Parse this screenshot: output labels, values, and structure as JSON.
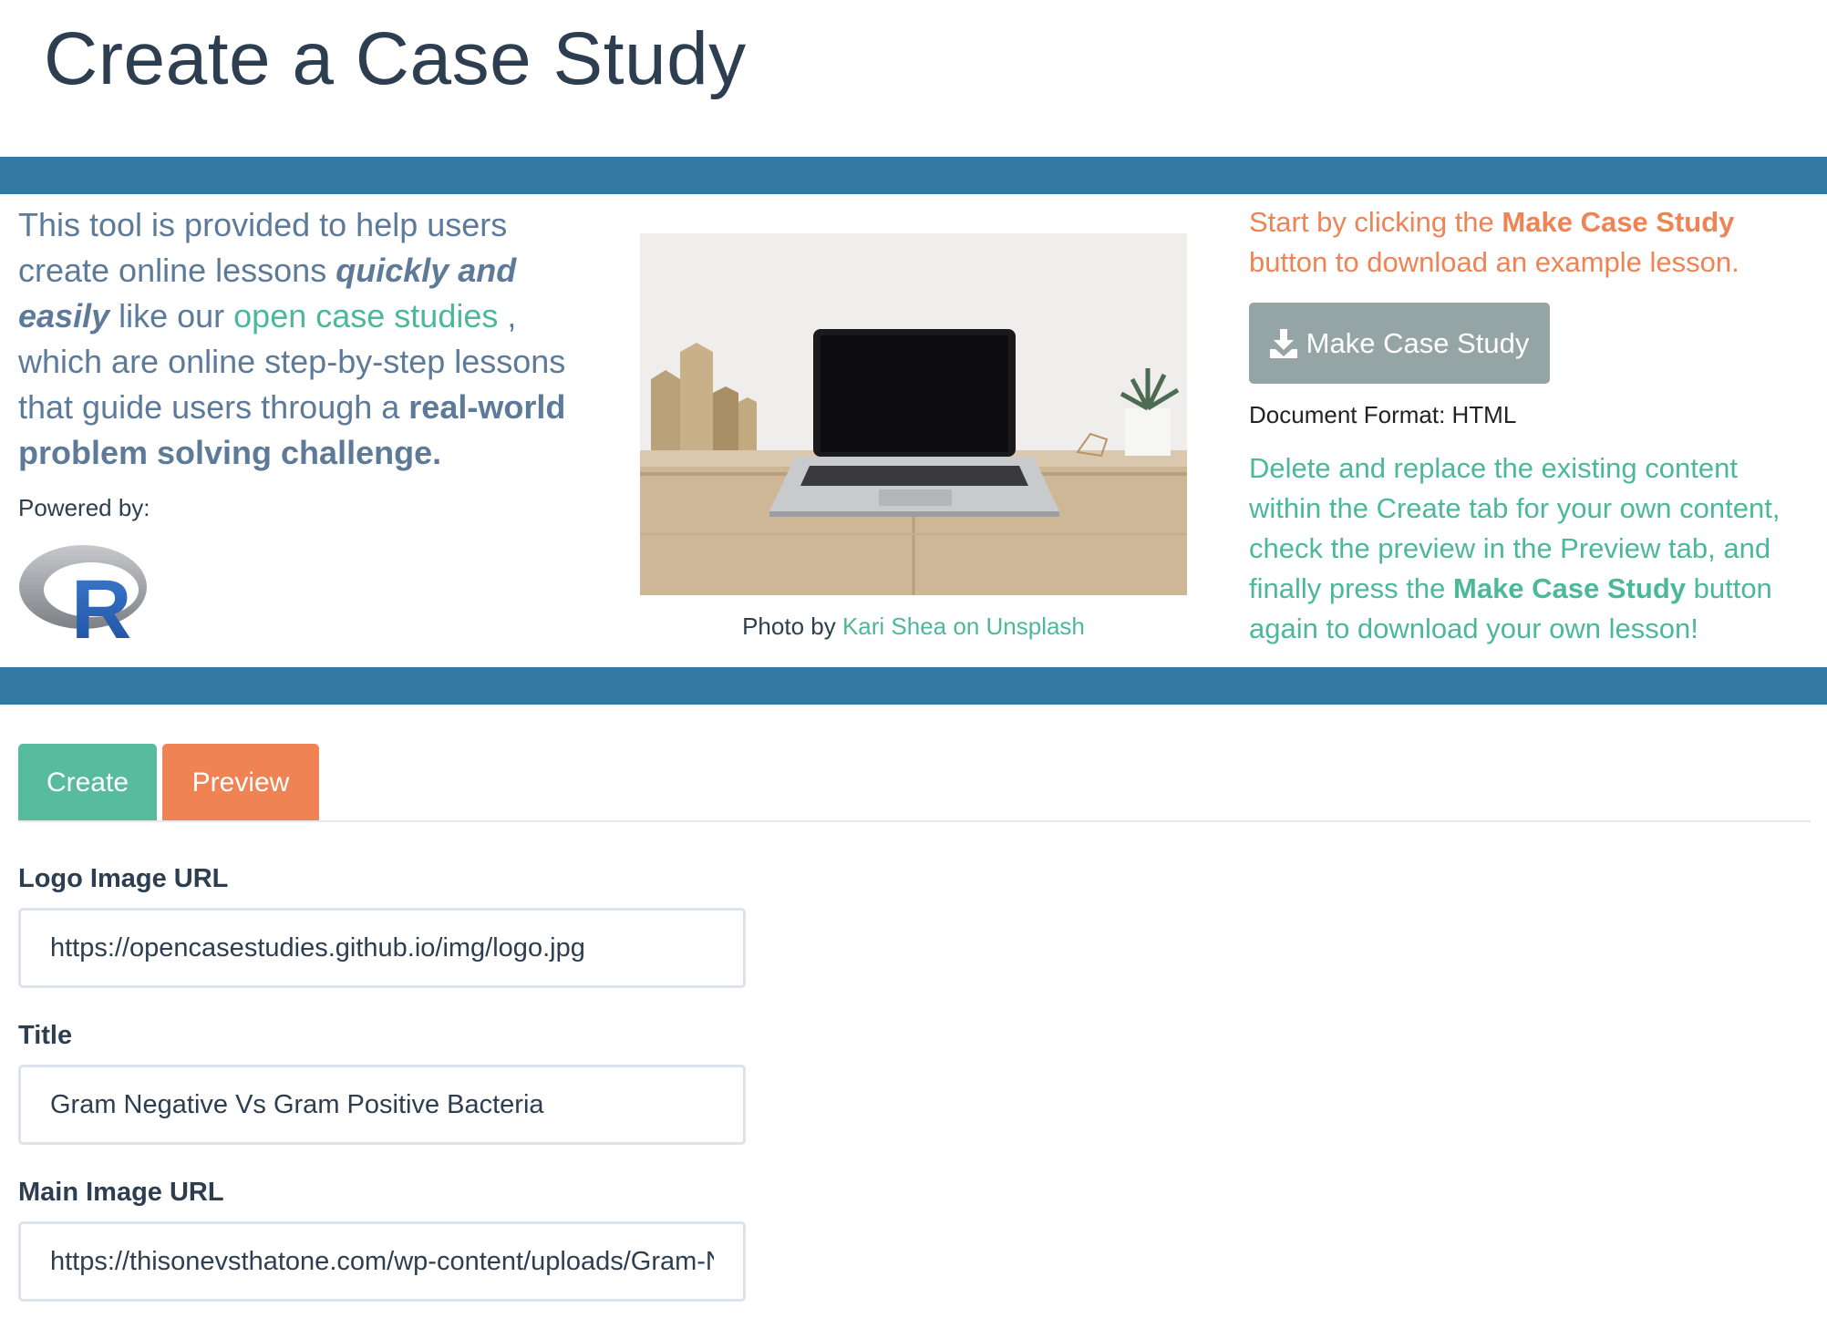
{
  "page": {
    "title": "Create a Case Study"
  },
  "intro": {
    "part1": "This tool is provided to help users create online lessons ",
    "emphasis": "quickly and easily",
    "part2": " like our ",
    "link": "open case studies",
    "part3": " , which are online step-by-step lessons that guide users through a ",
    "strong": "real-world problem solving challenge.",
    "powered_by": "Powered by:",
    "logo_letter": "R"
  },
  "photo": {
    "caption_prefix": "Photo by ",
    "caption_link": "Kari Shea on Unsplash"
  },
  "right": {
    "start_prefix": "Start by clicking the ",
    "start_strong": "Make Case Study",
    "start_suffix": " button to download an example lesson.",
    "make_button": "Make Case Study",
    "doc_format": "Document Format: HTML",
    "delete_prefix": "Delete and replace the existing content within the Create tab for your own content, check the preview in the Preview tab, and finally press the ",
    "delete_strong": "Make Case Study",
    "delete_suffix": " button again to download your own lesson!"
  },
  "tabs": [
    {
      "label": "Create",
      "active": true
    },
    {
      "label": "Preview",
      "active": false
    }
  ],
  "form": {
    "logo_label": "Logo Image URL",
    "logo_value": "https://opencasestudies.github.io/img/logo.jpg",
    "title_label": "Title",
    "title_value": "Gram Negative Vs Gram Positive Bacteria",
    "main_image_label": "Main Image URL",
    "main_image_value": "https://thisonevsthatone.com/wp-content/uploads/Gram-Negative-Vs-Gram-Positive-Bacteria.jpg"
  },
  "colors": {
    "band": "#3279a5",
    "green": "#57bc9c",
    "orange": "#ef8354",
    "grey_button": "#95a5a6",
    "title": "#2c3e50"
  },
  "icons": {
    "download": "download-icon",
    "r_logo": "r-logo"
  }
}
